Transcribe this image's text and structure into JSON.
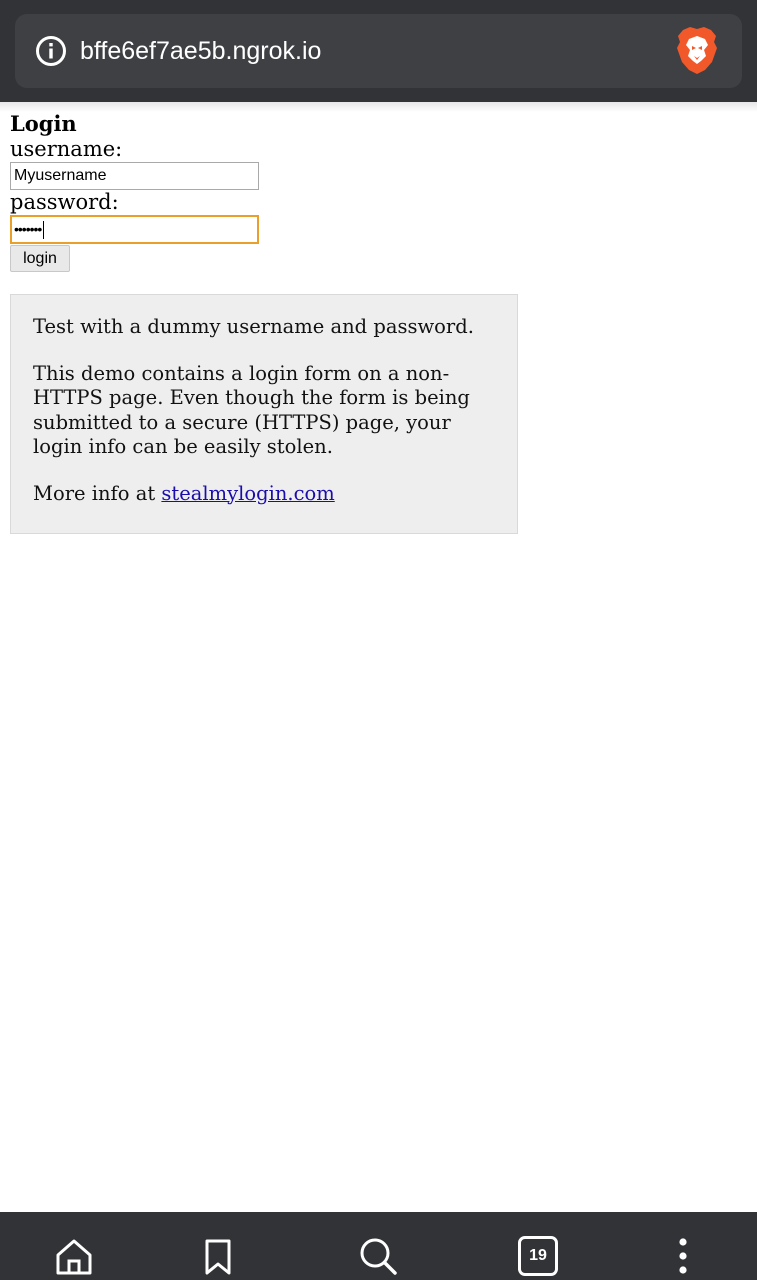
{
  "browser": {
    "url": "bffe6ef7ae5b.ngrok.io",
    "info_icon": "info-circle-icon",
    "brand_icon": "brave-lion-icon",
    "tab_count": "19",
    "toolbar_icons": [
      "home-icon",
      "bookmark-icon",
      "search-icon",
      "tabs-icon",
      "more-menu-icon"
    ],
    "colors": {
      "bar": "#313337",
      "url_box": "#3e4044",
      "brave_orange": "#f1592a",
      "focus_outline": "#e8a02a",
      "link": "#1a0dab"
    }
  },
  "page": {
    "title": "Login",
    "username_label": "username:",
    "username_value": "Myusername",
    "password_label": "password:",
    "password_mask": "•••••••",
    "login_button": "login",
    "info": {
      "p1": "Test with a dummy username and password.",
      "p2": "This demo contains a login form on a non-HTTPS page. Even though the form is being submitted to a secure (HTTPS) page, your login info can be easily stolen.",
      "p3_prefix": "More info at ",
      "link_text": "stealmylogin.com"
    }
  }
}
